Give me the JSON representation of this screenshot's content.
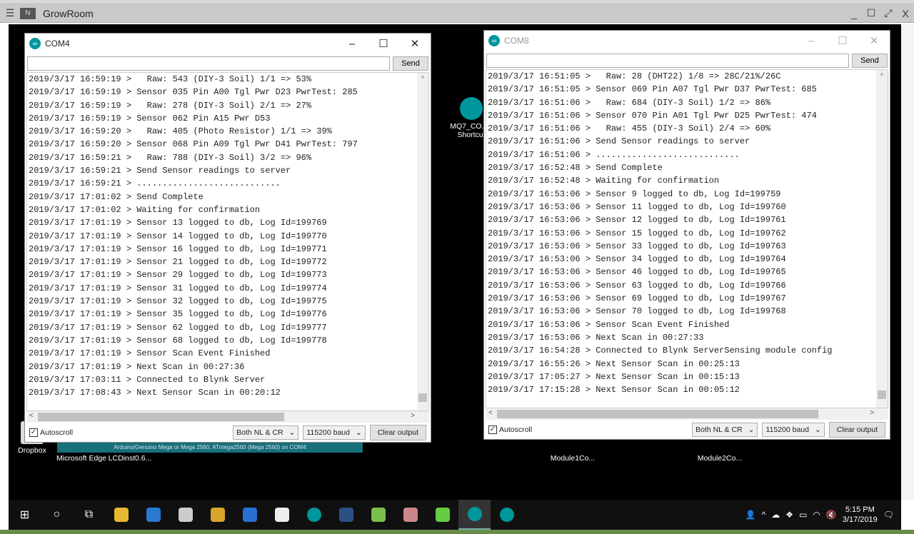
{
  "remote": {
    "title": "GrowRoom",
    "menu_icon": "hamburger-icon",
    "controls": [
      "_",
      "☐",
      "⤢",
      "X"
    ]
  },
  "com4": {
    "title": "COM4",
    "send": "Send",
    "input": "",
    "autoscroll": "Autoscroll",
    "line_ending": "Both NL & CR",
    "baud": "115200 baud",
    "clear": "Clear output",
    "lines": [
      "2019/3/17 16:59:19 >   Raw: 543 (DIY-3 Soil) 1/1 => 53%",
      "2019/3/17 16:59:19 > Sensor 035 Pin A00 Tgl Pwr D23 PwrTest: 285",
      "2019/3/17 16:59:19 >   Raw: 278 (DIY-3 Soil) 2/1 => 27%",
      "2019/3/17 16:59:19 > Sensor 062 Pin A15 Pwr D53",
      "2019/3/17 16:59:20 >   Raw: 405 (Photo Resistor) 1/1 => 39%",
      "2019/3/17 16:59:20 > Sensor 068 Pin A09 Tgl Pwr D41 PwrTest: 797",
      "2019/3/17 16:59:21 >   Raw: 788 (DIY-3 Soil) 3/2 => 96%",
      "2019/3/17 16:59:21 > Send Sensor readings to server",
      "2019/3/17 16:59:21 > ............................",
      "2019/3/17 17:01:02 > Send Complete",
      "2019/3/17 17:01:02 > Waiting for confirmation",
      "2019/3/17 17:01:19 > Sensor 13 logged to db, Log Id=199769",
      "2019/3/17 17:01:19 > Sensor 14 logged to db, Log Id=199770",
      "2019/3/17 17:01:19 > Sensor 16 logged to db, Log Id=199771",
      "2019/3/17 17:01:19 > Sensor 21 logged to db, Log Id=199772",
      "2019/3/17 17:01:19 > Sensor 29 logged to db, Log Id=199773",
      "2019/3/17 17:01:19 > Sensor 31 logged to db, Log Id=199774",
      "2019/3/17 17:01:19 > Sensor 32 logged to db, Log Id=199775",
      "2019/3/17 17:01:19 > Sensor 35 logged to db, Log Id=199776",
      "2019/3/17 17:01:19 > Sensor 62 logged to db, Log Id=199777",
      "2019/3/17 17:01:19 > Sensor 68 logged to db, Log Id=199778",
      "2019/3/17 17:01:19 > Sensor Scan Event Finished",
      "2019/3/17 17:01:19 > Next Scan in 00:27:36",
      "2019/3/17 17:03:11 > Connected to Blynk Server",
      "2019/3/17 17:08:43 > Next Sensor Scan in 00:20:12"
    ]
  },
  "com8": {
    "title": "COM8",
    "send": "Send",
    "input": "",
    "autoscroll": "Autoscroll",
    "line_ending": "Both NL & CR",
    "baud": "115200 baud",
    "clear": "Clear output",
    "lines": [
      "2019/3/17 16:51:05 >   Raw: 28 (DHT22) 1/8 => 28C/21%/26C",
      "2019/3/17 16:51:05 > Sensor 069 Pin A07 Tgl Pwr D37 PwrTest: 685",
      "2019/3/17 16:51:06 >   Raw: 684 (DIY-3 Soil) 1/2 => 86%",
      "2019/3/17 16:51:06 > Sensor 070 Pin A01 Tgl Pwr D25 PwrTest: 474",
      "2019/3/17 16:51:06 >   Raw: 455 (DIY-3 Soil) 2/4 => 60%",
      "2019/3/17 16:51:06 > Send Sensor readings to server",
      "2019/3/17 16:51:06 > ............................",
      "2019/3/17 16:52:48 > Send Complete",
      "2019/3/17 16:52:48 > Waiting for confirmation",
      "2019/3/17 16:53:06 > Sensor 9 logged to db, Log Id=199759",
      "2019/3/17 16:53:06 > Sensor 11 logged to db, Log Id=199760",
      "2019/3/17 16:53:06 > Sensor 12 logged to db, Log Id=199761",
      "2019/3/17 16:53:06 > Sensor 15 logged to db, Log Id=199762",
      "2019/3/17 16:53:06 > Sensor 33 logged to db, Log Id=199763",
      "2019/3/17 16:53:06 > Sensor 34 logged to db, Log Id=199764",
      "2019/3/17 16:53:06 > Sensor 46 logged to db, Log Id=199765",
      "2019/3/17 16:53:06 > Sensor 63 logged to db, Log Id=199766",
      "2019/3/17 16:53:06 > Sensor 69 logged to db, Log Id=199767",
      "2019/3/17 16:53:06 > Sensor 70 logged to db, Log Id=199768",
      "2019/3/17 16:53:06 > Sensor Scan Event Finished",
      "2019/3/17 16:53:06 > Next Scan in 00:27:33",
      "2019/3/17 16:54:28 > Connected to Blynk ServerSensing module config",
      "2019/3/17 16:55:26 > Next Sensor Scan in 00:25:13",
      "2019/3/17 17:05:27 > Next Sensor Scan in 00:15:13",
      "2019/3/17 17:15:28 > Next Sensor Scan in 00:05:12"
    ]
  },
  "ide_status": "Arduino/Genuino Mega or Mega 2560, ATmega2560 (Mega 2560) on COM4",
  "desktop_icons": {
    "dropbox": "Dropbox",
    "edge": "Microsoft Edge",
    "lcd": "LCDinst0.6...",
    "mq7": "MQ7_CO... - Shortcut",
    "module1": "Module1Co...",
    "module2": "Module2Co..."
  },
  "taskbar": {
    "time": "5:15 PM",
    "date": "3/17/2019",
    "apps": [
      "start",
      "search",
      "task-view",
      "file-explorer",
      "store",
      "app-disc",
      "chrome",
      "dropbox",
      "fb",
      "arduino",
      "app-blue",
      "android-studio",
      "app-paint",
      "app-gem",
      "arduino-active",
      "arduino"
    ]
  },
  "colors": {
    "arduino": "#00979c",
    "desktop": "#000000"
  }
}
